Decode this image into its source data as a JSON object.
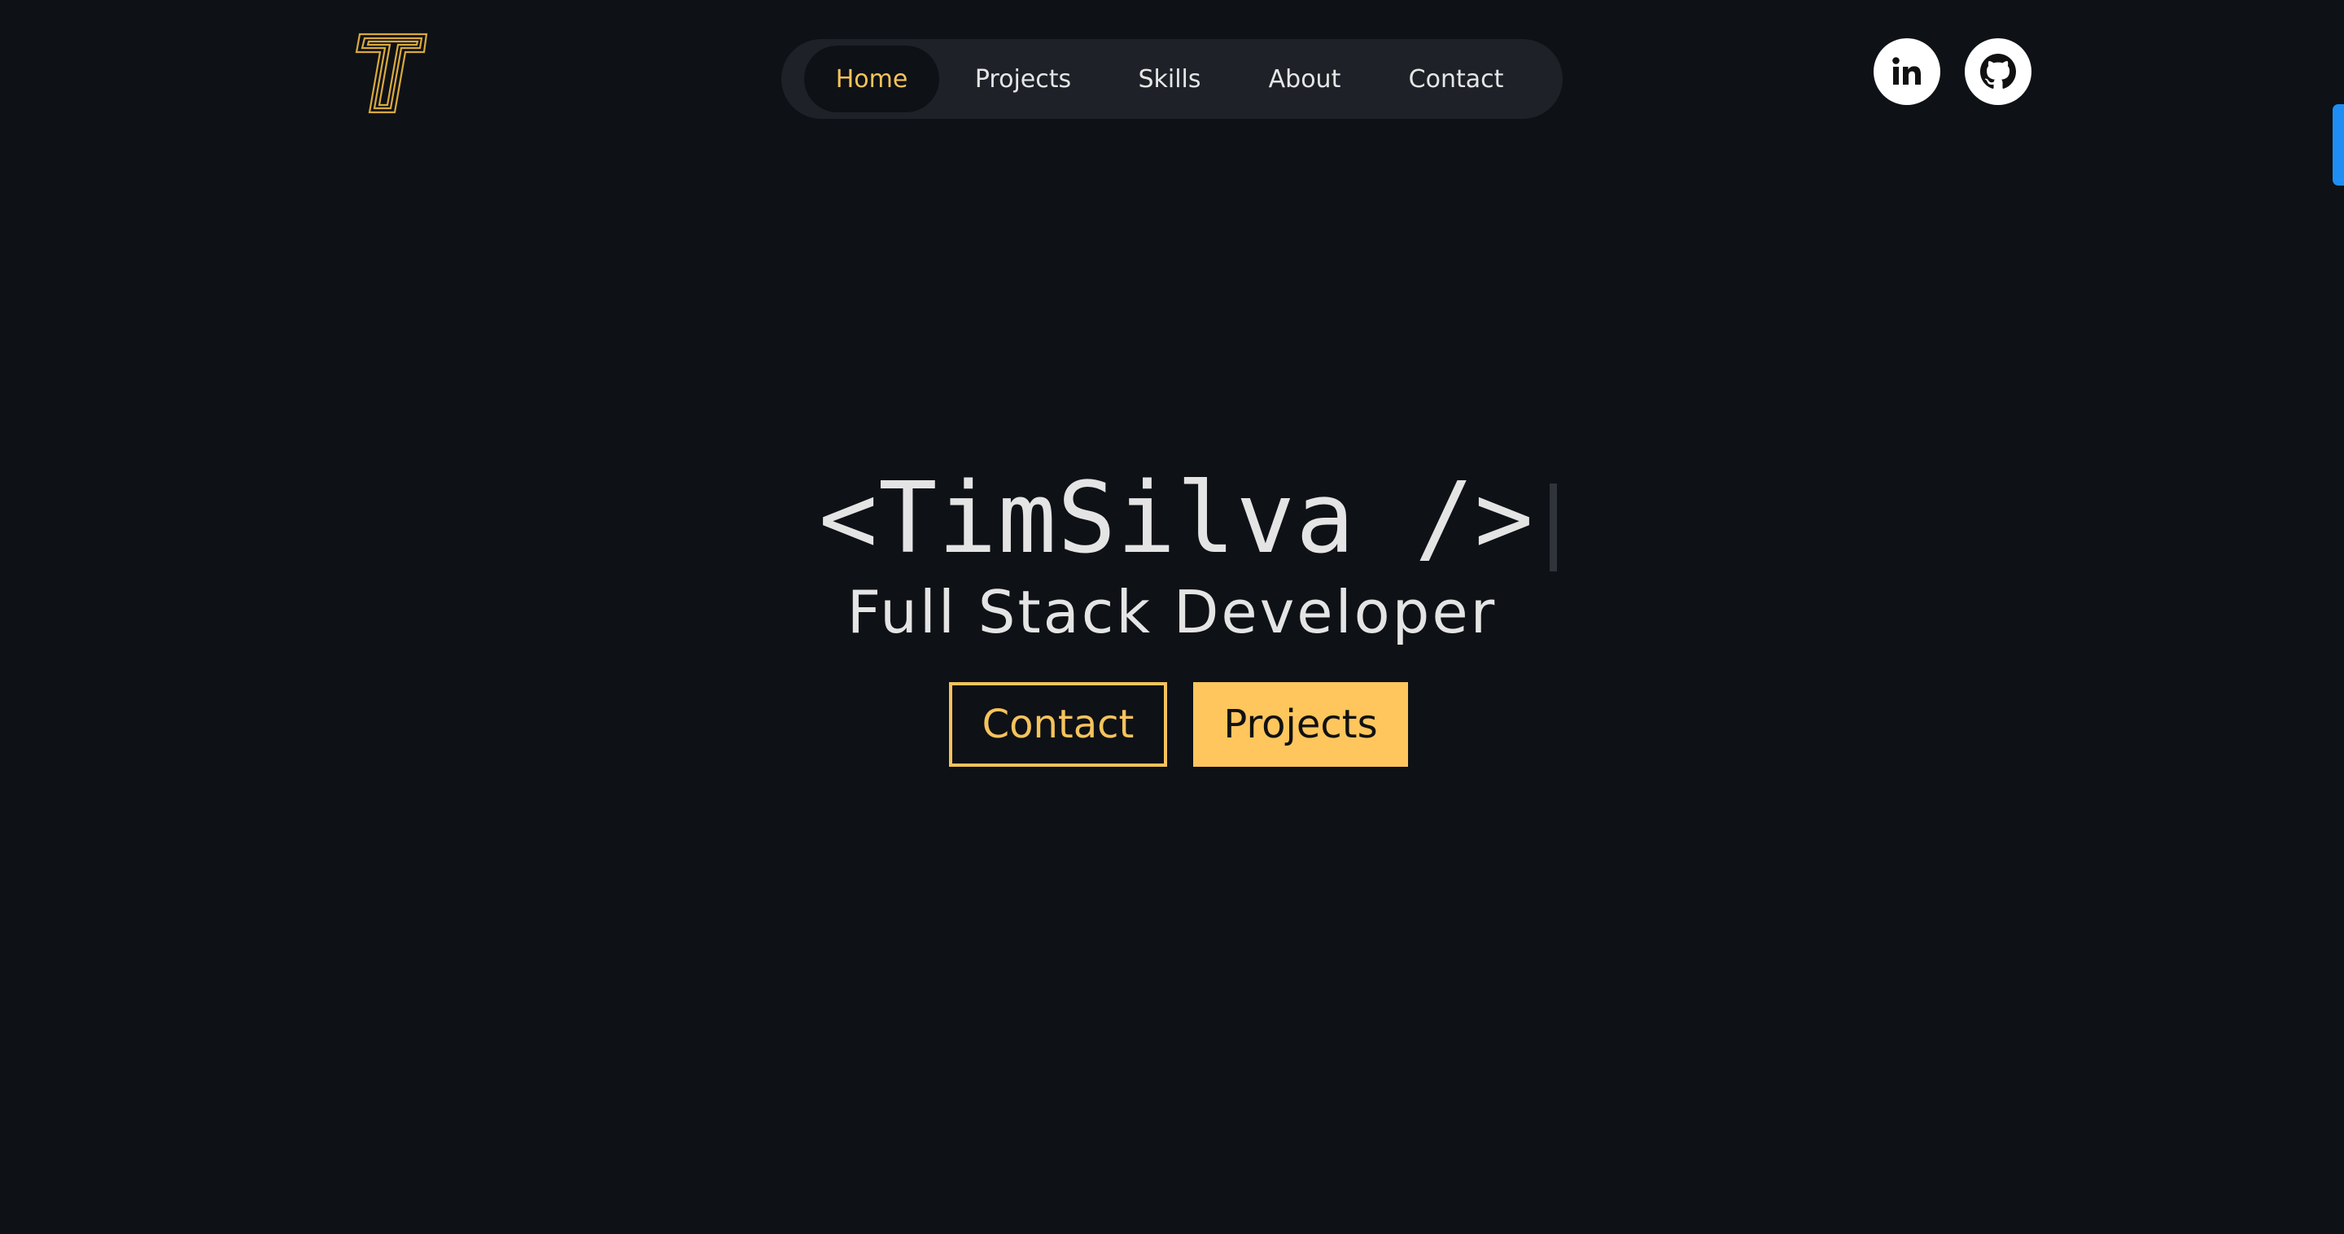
{
  "header": {
    "logo_icon": "t-outline-logo-icon",
    "nav": {
      "items": [
        {
          "label": "Home",
          "active": true
        },
        {
          "label": "Projects",
          "active": false
        },
        {
          "label": "Skills",
          "active": false
        },
        {
          "label": "About",
          "active": false
        },
        {
          "label": "Contact",
          "active": false
        }
      ]
    },
    "social": [
      {
        "icon": "linkedin-icon"
      },
      {
        "icon": "github-icon"
      }
    ]
  },
  "hero": {
    "title": "<TimSilva />",
    "subtitle": "Full Stack Developer",
    "buttons": {
      "contact_label": "Contact",
      "projects_label": "Projects"
    }
  },
  "colors": {
    "background": "#0e1116",
    "nav_background": "#1e2228",
    "accent": "#f5c35c",
    "text": "#e4e4e4",
    "scrollbar": "#1e8ef5"
  }
}
